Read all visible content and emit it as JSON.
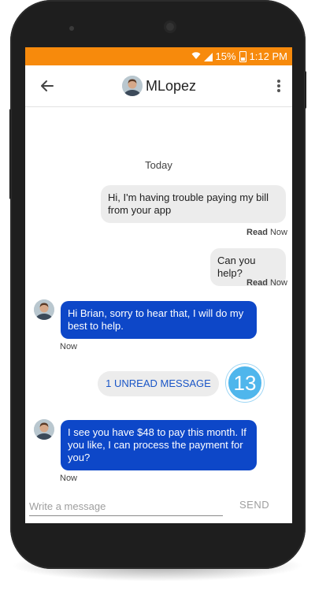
{
  "status_bar": {
    "battery": "15%",
    "time": "1:12 PM",
    "icons": [
      "wifi-icon",
      "signal-icon",
      "battery-icon"
    ],
    "color": "#f78a0c"
  },
  "header": {
    "title": "MLopez",
    "icons": [
      "back-arrow-icon",
      "more-vert-icon"
    ]
  },
  "chat": {
    "date_label": "Today",
    "messages": [
      {
        "direction": "outgoing",
        "text": "Hi, I'm having trouble paying my bill from your app",
        "status": "Read",
        "time": "Now"
      },
      {
        "direction": "outgoing",
        "text": "Can you help?",
        "status": "Read",
        "time": "Now"
      },
      {
        "direction": "incoming",
        "text": "Hi Brian, sorry to hear that, I will do my best to help.",
        "time": "Now"
      },
      {
        "direction": "incoming",
        "text": "I see you have $48 to pay this month. If you like, I can process the payment for you?",
        "time": "Now"
      }
    ],
    "unread": {
      "label": "1 UNREAD MESSAGE",
      "count": "13"
    }
  },
  "composer": {
    "placeholder": "Write a message",
    "value": "",
    "send_label": "SEND"
  },
  "colors": {
    "incoming_bubble": "#0d47c8",
    "outgoing_bubble": "#ececec",
    "badge": "#4fb6ec"
  }
}
